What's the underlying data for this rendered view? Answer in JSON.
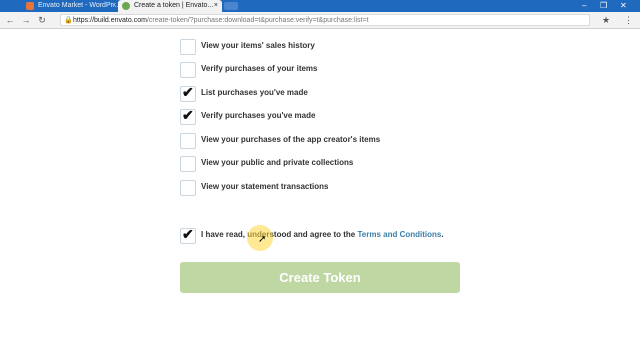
{
  "browser": {
    "tabs": [
      {
        "label": "Envato Market - WordPr...",
        "close": "×"
      },
      {
        "label": "Create a token | Envato...",
        "close": "×"
      }
    ],
    "url_host": "https://build.envato.com",
    "url_path": "/create-token/?purchase:download=t&purchase:verify=t&purchase:list=t",
    "window_controls": [
      "–",
      "❐",
      "✕"
    ],
    "nav": {
      "back": "←",
      "forward": "→",
      "reload": "↻"
    }
  },
  "permissions": [
    {
      "label": "View your items' sales history",
      "checked": false
    },
    {
      "label": "Verify purchases of your items",
      "checked": false
    },
    {
      "label": "List purchases you've made",
      "checked": true
    },
    {
      "label": "Verify purchases you've made",
      "checked": true
    },
    {
      "label": "View your purchases of the app creator's items",
      "checked": false
    },
    {
      "label": "View your public and private collections",
      "checked": false
    },
    {
      "label": "View your statement transactions",
      "checked": false
    }
  ],
  "agree": {
    "checked": true,
    "prefix": "I have read, understood and agree to the ",
    "link": "Terms and Conditions",
    "suffix": "."
  },
  "create_button": "Create Token",
  "check_mark": "✔"
}
